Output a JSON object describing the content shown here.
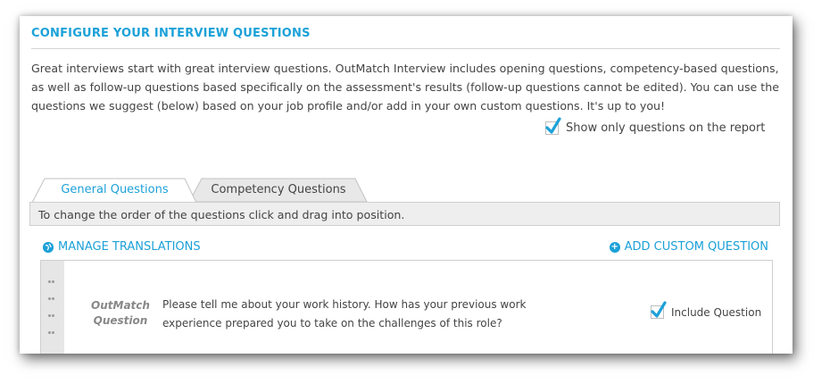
{
  "header": {
    "title": "CONFIGURE YOUR INTERVIEW QUESTIONS",
    "intro": "Great interviews start with great interview questions. OutMatch Interview includes opening questions, competency-based questions, as well as follow-up questions based specifically on the assessment's results (follow-up questions cannot be edited). You can use the questions we suggest (below) based on your job profile and/or add in your own custom questions. It's up to you!"
  },
  "report_filter": {
    "label": "Show only questions on the report",
    "checked": true
  },
  "tabs": [
    {
      "label": "General Questions",
      "active": true
    },
    {
      "label": "Competency Questions",
      "active": false
    }
  ],
  "hint": "To change the order of the questions click and drag into position.",
  "actions": {
    "manage_translations": "MANAGE TRANSLATIONS",
    "add_custom_question": "ADD CUSTOM QUESTION"
  },
  "questions": [
    {
      "source_line1": "OutMatch",
      "source_line2": "Question",
      "text": "Please tell me about your work history. How has your previous work experience prepared you to take on the challenges of this role?",
      "include_label": "Include Question",
      "included": true
    }
  ],
  "colors": {
    "accent": "#1ca1d8",
    "text": "#444444",
    "muted": "#888888",
    "hint_bg": "#eeeeee"
  },
  "icons": {
    "manage": "globe-icon",
    "add": "plus-circle-icon",
    "drag": "drag-handle-icon",
    "check": "checkmark-icon"
  }
}
